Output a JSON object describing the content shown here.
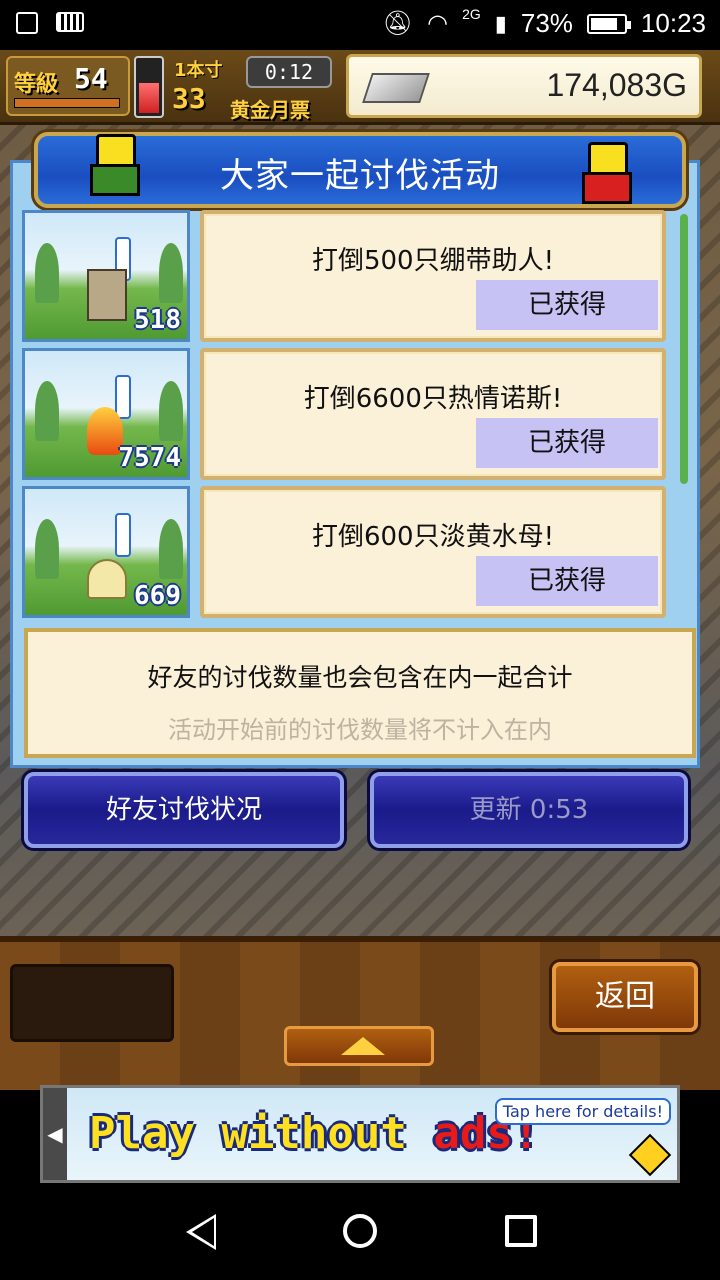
{
  "status_bar": {
    "network": "2G",
    "battery": "73%",
    "battery_level": 0.73,
    "time": "10:23"
  },
  "hud": {
    "level_label": "等級",
    "level": "54",
    "ticket_icon_text": "1本寸",
    "ticket_count": "33",
    "ticket_timer": "0:12",
    "ticket_label": "黄金月票",
    "gold": "174,083G"
  },
  "dialog": {
    "title": "大家一起讨伐活动",
    "missions": [
      {
        "goal": "打倒500只绷带助人!",
        "count": "518",
        "status": "已获得",
        "monster_icon": "bandage-monster"
      },
      {
        "goal": "打倒6600只热情诺斯!",
        "count": "7574",
        "status": "已获得",
        "monster_icon": "fire-monster"
      },
      {
        "goal": "打倒600只淡黄水母!",
        "count": "669",
        "status": "已获得",
        "monster_icon": "jellyfish-monster"
      }
    ],
    "note_line1": "好友的讨伐数量也会包含在内一起合计",
    "note_line2": "活动开始前的讨伐数量将不计入在内",
    "friend_button": "好友讨伐状况",
    "refresh_button": "更新 0:53"
  },
  "panel": {
    "back_button": "返回"
  },
  "ad": {
    "text_main": "Play without ",
    "text_red": "ads!",
    "tap": "Tap here for details!"
  },
  "colors": {
    "title_blue": "#1a4ec0",
    "status_purple": "#c7c2f4",
    "card_bg": "#fbf0d8"
  }
}
